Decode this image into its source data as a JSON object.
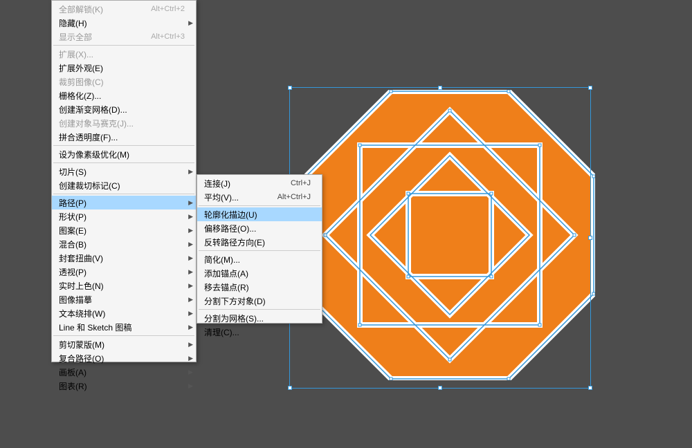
{
  "colors": {
    "shape_fill": "#ef7f1a",
    "shape_stroke": "#3498db",
    "selection": "#3498db",
    "bg": "#4d4d4d"
  },
  "menu_main": [
    {
      "label": "全部解锁(K)",
      "shortcut": "Alt+Ctrl+2",
      "disabled": true
    },
    {
      "label": "隐藏(H)",
      "submenu": true
    },
    {
      "label": "显示全部",
      "shortcut": "Alt+Ctrl+3",
      "disabled": true
    },
    {
      "sep": true
    },
    {
      "label": "扩展(X)...",
      "disabled": true
    },
    {
      "label": "扩展外观(E)"
    },
    {
      "label": "裁剪图像(C)",
      "disabled": true
    },
    {
      "label": "栅格化(Z)..."
    },
    {
      "label": "创建渐变网格(D)..."
    },
    {
      "label": "创建对象马赛克(J)...",
      "disabled": true
    },
    {
      "label": "拼合透明度(F)..."
    },
    {
      "sep": true
    },
    {
      "label": "设为像素级优化(M)"
    },
    {
      "sep": true
    },
    {
      "label": "切片(S)",
      "submenu": true
    },
    {
      "label": "创建裁切标记(C)"
    },
    {
      "sep": true
    },
    {
      "label": "路径(P)",
      "submenu": true,
      "highlight": true
    },
    {
      "label": "形状(P)",
      "submenu": true
    },
    {
      "label": "图案(E)",
      "submenu": true
    },
    {
      "label": "混合(B)",
      "submenu": true
    },
    {
      "label": "封套扭曲(V)",
      "submenu": true
    },
    {
      "label": "透视(P)",
      "submenu": true
    },
    {
      "label": "实时上色(N)",
      "submenu": true
    },
    {
      "label": "图像描摹",
      "submenu": true
    },
    {
      "label": "文本绕排(W)",
      "submenu": true
    },
    {
      "label": "Line 和 Sketch 图稿",
      "submenu": true
    },
    {
      "sep": true
    },
    {
      "label": "剪切蒙版(M)",
      "submenu": true
    },
    {
      "label": "复合路径(O)",
      "submenu": true
    },
    {
      "label": "画板(A)",
      "submenu": true
    },
    {
      "label": "图表(R)",
      "submenu": true
    }
  ],
  "menu_sub": [
    {
      "label": "连接(J)",
      "shortcut": "Ctrl+J"
    },
    {
      "label": "平均(V)...",
      "shortcut": "Alt+Ctrl+J"
    },
    {
      "sep": true
    },
    {
      "label": "轮廓化描边(U)",
      "highlight": true
    },
    {
      "label": "偏移路径(O)..."
    },
    {
      "label": "反转路径方向(E)"
    },
    {
      "sep": true
    },
    {
      "label": "简化(M)..."
    },
    {
      "label": "添加锚点(A)"
    },
    {
      "label": "移去锚点(R)"
    },
    {
      "label": "分割下方对象(D)"
    },
    {
      "sep": true
    },
    {
      "label": "分割为网格(S)..."
    },
    {
      "label": "清理(C)..."
    }
  ]
}
